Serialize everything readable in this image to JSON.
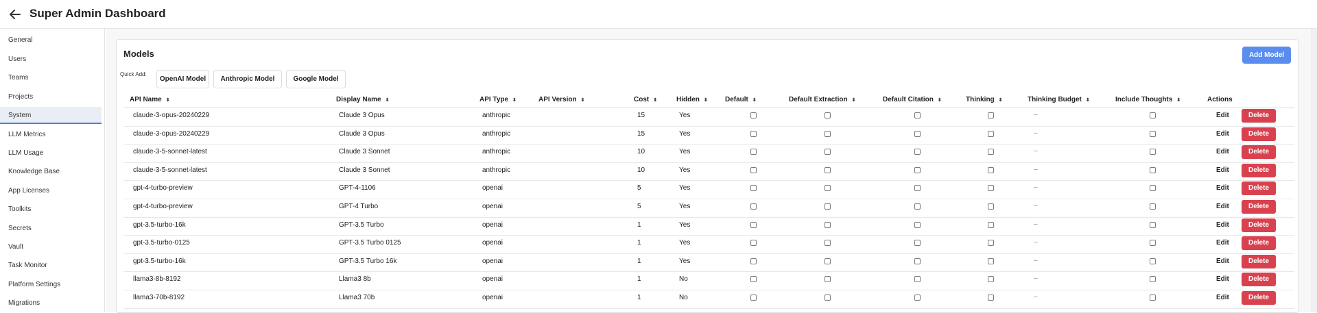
{
  "header": {
    "title": "Super Admin Dashboard",
    "back_icon": "arrow-left-icon"
  },
  "sidebar": {
    "items": [
      {
        "label": "General"
      },
      {
        "label": "Users"
      },
      {
        "label": "Teams"
      },
      {
        "label": "Projects"
      },
      {
        "label": "System",
        "active": true
      },
      {
        "label": "LLM Metrics"
      },
      {
        "label": "LLM Usage"
      },
      {
        "label": "Knowledge Base"
      },
      {
        "label": "App Licenses"
      },
      {
        "label": "Toolkits"
      },
      {
        "label": "Secrets"
      },
      {
        "label": "Vault"
      },
      {
        "label": "Task Monitor"
      },
      {
        "label": "Platform Settings"
      },
      {
        "label": "Migrations"
      }
    ]
  },
  "models": {
    "title": "Models",
    "add_button": "Add Model",
    "quick_add_label": "Quick Add:",
    "quick_add": [
      "OpenAI Model",
      "Anthropic Model",
      "Google Model"
    ],
    "columns": [
      "API Name",
      "Display Name",
      "API Type",
      "API Version",
      "Cost",
      "Hidden",
      "Default",
      "Default Extraction",
      "Default Citation",
      "Thinking",
      "Thinking Budget",
      "Include Thoughts",
      "Actions"
    ],
    "edit_label": "Edit",
    "delete_label": "Delete",
    "empty_budget": "–",
    "rows": [
      {
        "api_name": "claude-3-opus-20240229",
        "display_name": "Claude 3 Opus",
        "api_type": "anthropic",
        "cost": "15",
        "hidden": "Yes"
      },
      {
        "api_name": "claude-3-opus-20240229",
        "display_name": "Claude 3 Opus",
        "api_type": "anthropic",
        "cost": "15",
        "hidden": "Yes"
      },
      {
        "api_name": "claude-3-5-sonnet-latest",
        "display_name": "Claude 3 Sonnet",
        "api_type": "anthropic",
        "cost": "10",
        "hidden": "Yes"
      },
      {
        "api_name": "claude-3-5-sonnet-latest",
        "display_name": "Claude 3 Sonnet",
        "api_type": "anthropic",
        "cost": "10",
        "hidden": "Yes"
      },
      {
        "api_name": "gpt-4-turbo-preview",
        "display_name": "GPT-4-1106",
        "api_type": "openai",
        "cost": "5",
        "hidden": "Yes"
      },
      {
        "api_name": "gpt-4-turbo-preview",
        "display_name": "GPT-4 Turbo",
        "api_type": "openai",
        "cost": "5",
        "hidden": "Yes"
      },
      {
        "api_name": "gpt-3.5-turbo-16k",
        "display_name": "GPT-3.5 Turbo",
        "api_type": "openai",
        "cost": "1",
        "hidden": "Yes"
      },
      {
        "api_name": "gpt-3.5-turbo-0125",
        "display_name": "GPT-3.5 Turbo 0125",
        "api_type": "openai",
        "cost": "1",
        "hidden": "Yes"
      },
      {
        "api_name": "gpt-3.5-turbo-16k",
        "display_name": "GPT-3.5 Turbo 16k",
        "api_type": "openai",
        "cost": "1",
        "hidden": "Yes"
      },
      {
        "api_name": "llama3-8b-8192",
        "display_name": "Llama3 8b",
        "api_type": "openai",
        "cost": "1",
        "hidden": "No"
      },
      {
        "api_name": "llama3-70b-8192",
        "display_name": "Llama3 70b",
        "api_type": "openai",
        "cost": "1",
        "hidden": "No"
      }
    ]
  },
  "colors": {
    "accent": "#5b8def",
    "danger": "#d9414f",
    "active_bg": "#e9eef6"
  }
}
